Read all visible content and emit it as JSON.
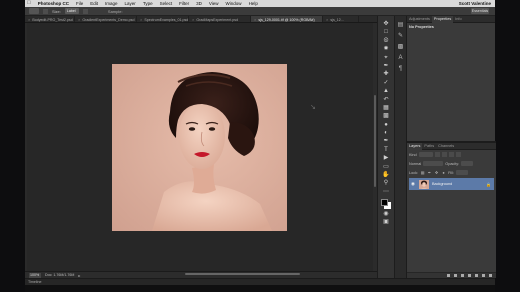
{
  "app": {
    "name": "Photoshop CC"
  },
  "menubar": {
    "apple_icon": "apple-icon",
    "items": [
      "File",
      "Edit",
      "Image",
      "Layer",
      "Type",
      "Select",
      "Filter",
      "3D",
      "View",
      "Window",
      "Help"
    ],
    "user": "Scott Valentine"
  },
  "options_bar": {
    "size_label": "Size:",
    "size_value": "Label",
    "sample_label": "Sample:",
    "workspace": "Essentials"
  },
  "tabs": [
    {
      "label": "Bodyedit-PRO_Test2.psd",
      "active": false
    },
    {
      "label": "GradientExperiments_Demo.psd",
      "active": false
    },
    {
      "label": "SpectrumExamples_01.psd",
      "active": false
    },
    {
      "label": "GradMapsExperiment.psd",
      "active": false
    },
    {
      "label": "sjs_129-0001.tif @ 100% (RGB/8#)",
      "active": true
    },
    {
      "label": "sjs_12...",
      "active": false
    }
  ],
  "status": {
    "zoom": "100%",
    "doc": "Doc: 1.76M/1.76M"
  },
  "timeline": {
    "label": "Timeline"
  },
  "panels": {
    "top_tabs": [
      "Adjustments",
      "Properties",
      "Info"
    ],
    "top_active": "Properties",
    "no_properties": "No Properties",
    "layers_tabs": [
      "Layers",
      "Paths",
      "Channels"
    ],
    "layers_active": "Layers",
    "kind_label": "Kind",
    "blend_mode": "Normal",
    "opacity_label": "Opacity:",
    "lock_label": "Lock:",
    "fill_label": "Fill:",
    "layer_name": "Background"
  }
}
